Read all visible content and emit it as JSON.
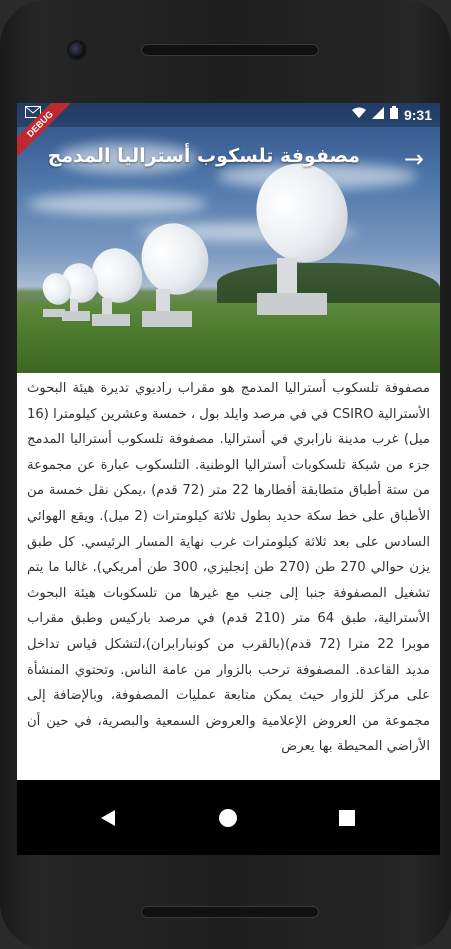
{
  "status_bar": {
    "time": "9:31",
    "debug_label": "DEBUG",
    "icons": [
      "gmail-icon",
      "wifi-icon",
      "signal-icon",
      "battery-icon"
    ]
  },
  "app_bar": {
    "title": "مصفوفة تلسكوب أستراليا المدمج",
    "back_icon": "arrow-forward-icon"
  },
  "article": {
    "text": "مصفوفة تلسكوب أستراليا المدمج هو مقراب راديوي تديرة هيئة البحوث الأسترالية CSIRO في في مرصد وايلد بول ، خمسة وعشرين كيلومترا (16 ميل) غرب مدينة نارابري في أستراليا. مصفوفة تلسكوب أستراليا المدمج جزء من شبكة تلسكوبات أستراليا الوطنية. التلسكوب عبارة عن مجموعة من ستة أطباق متطابقة أقطارها 22 متر (72 قدم) ،يمكن نقل خمسة من الأطباق على خط سكة حديد بطول ثلاثة كيلومترات (2 ميل). ويقع الهوائي السادس على بعد ثلاثة كيلومترات غرب نهاية المسار الرئيسي. كل طبق يزن حوالي 270 طن (270 طن إنجليزي، 300 طن أمريكي). غالبا ما يتم تشغيل المصفوفة جنبا إلى جنب مع غيرها من تلسكوبات هيئة البحوث الأسترالية، طبق 64 متر (210 قدم) في مرصد باركيس وطبق مقراب موبرا 22 مترا (72 قدم)(بالقرب من كونبارابران)،لتشكل قياس تداخل مديد القاعدة. المصفوفة ترحب بالزوار من عامة الناس. وتحتوي المنشأة على مركز للزوار حيث يمكن متابعة عمليات المصفوفة، وبالإضافة إلى مجموعة من العروض الإعلامية والعروض السمعية والبصرية، في حين أن الأراضي المحيطة بها يعرض"
  },
  "nav_bar": {
    "buttons": [
      "back-nav-icon",
      "home-nav-icon",
      "recents-nav-icon"
    ]
  }
}
